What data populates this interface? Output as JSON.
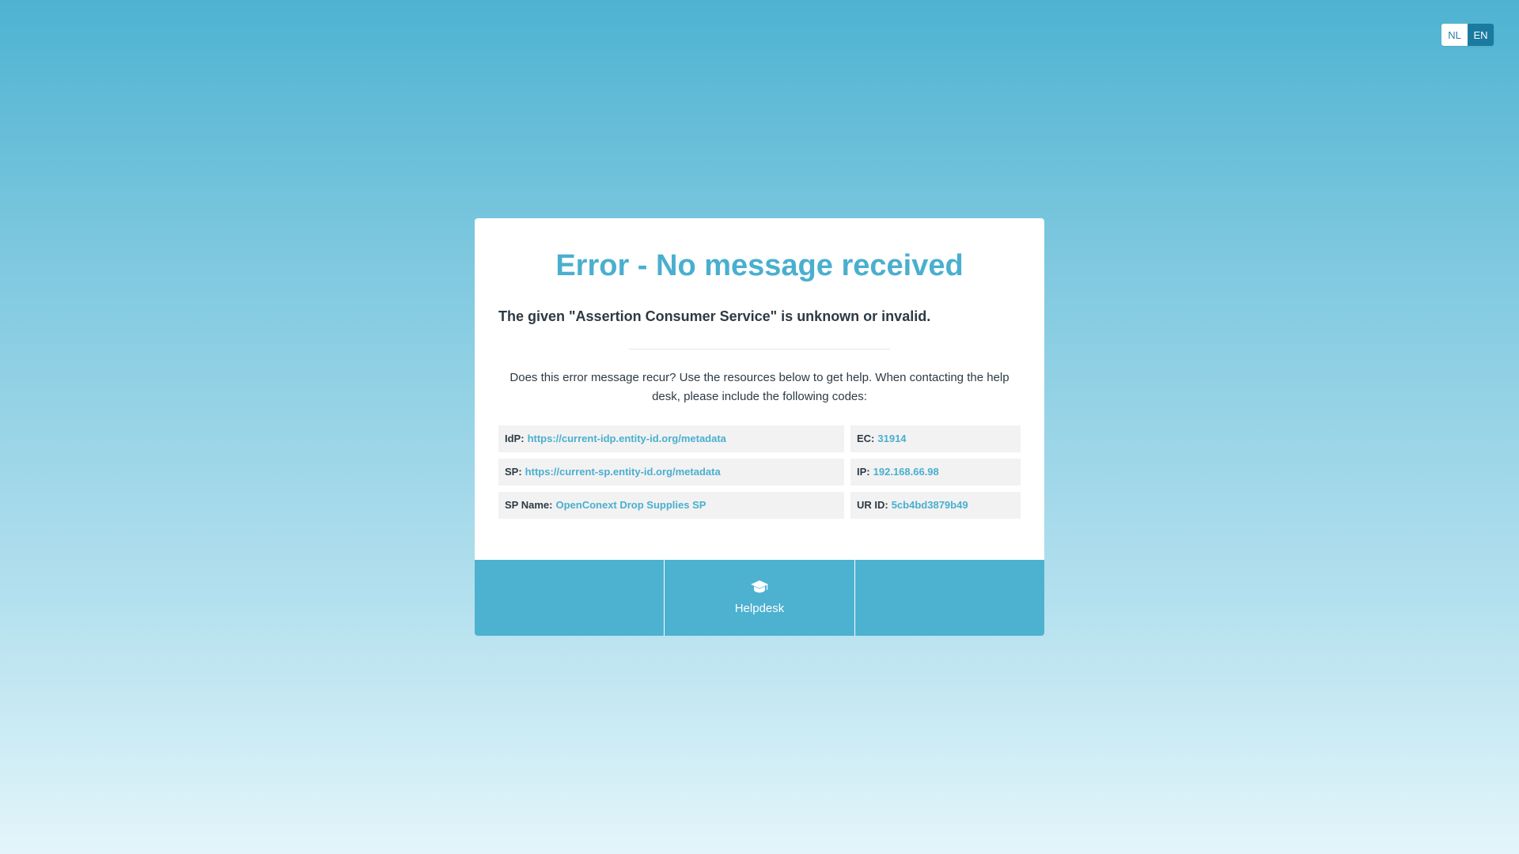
{
  "language": {
    "options": [
      {
        "code": "NL",
        "active": false
      },
      {
        "code": "EN",
        "active": true
      }
    ]
  },
  "error": {
    "title": "Error - No message received",
    "subtitle": "The given \"Assertion Consumer Service\" is unknown or invalid.",
    "help_text": "Does this error message recur? Use the resources below to get help. When contacting the help desk, please include the following codes:"
  },
  "codes": {
    "idp": {
      "label": "IdP:",
      "value": "https://current-idp.entity-id.org/metadata"
    },
    "ec": {
      "label": "EC:",
      "value": "31914"
    },
    "sp": {
      "label": "SP:",
      "value": "https://current-sp.entity-id.org/metadata"
    },
    "ip": {
      "label": "IP:",
      "value": "192.168.66.98"
    },
    "sp_name": {
      "label": "SP Name:",
      "value": "OpenConext Drop Supplies SP"
    },
    "ur_id": {
      "label": "UR ID:",
      "value": "5cb4bd3879b49"
    }
  },
  "footer": {
    "helpdesk_label": "Helpdesk",
    "helpdesk_icon": "graduation-cap-icon"
  },
  "colors": {
    "accent": "#4aafcf",
    "active_lang": "#1b7aa0",
    "footer_bg": "#4db1d0"
  }
}
